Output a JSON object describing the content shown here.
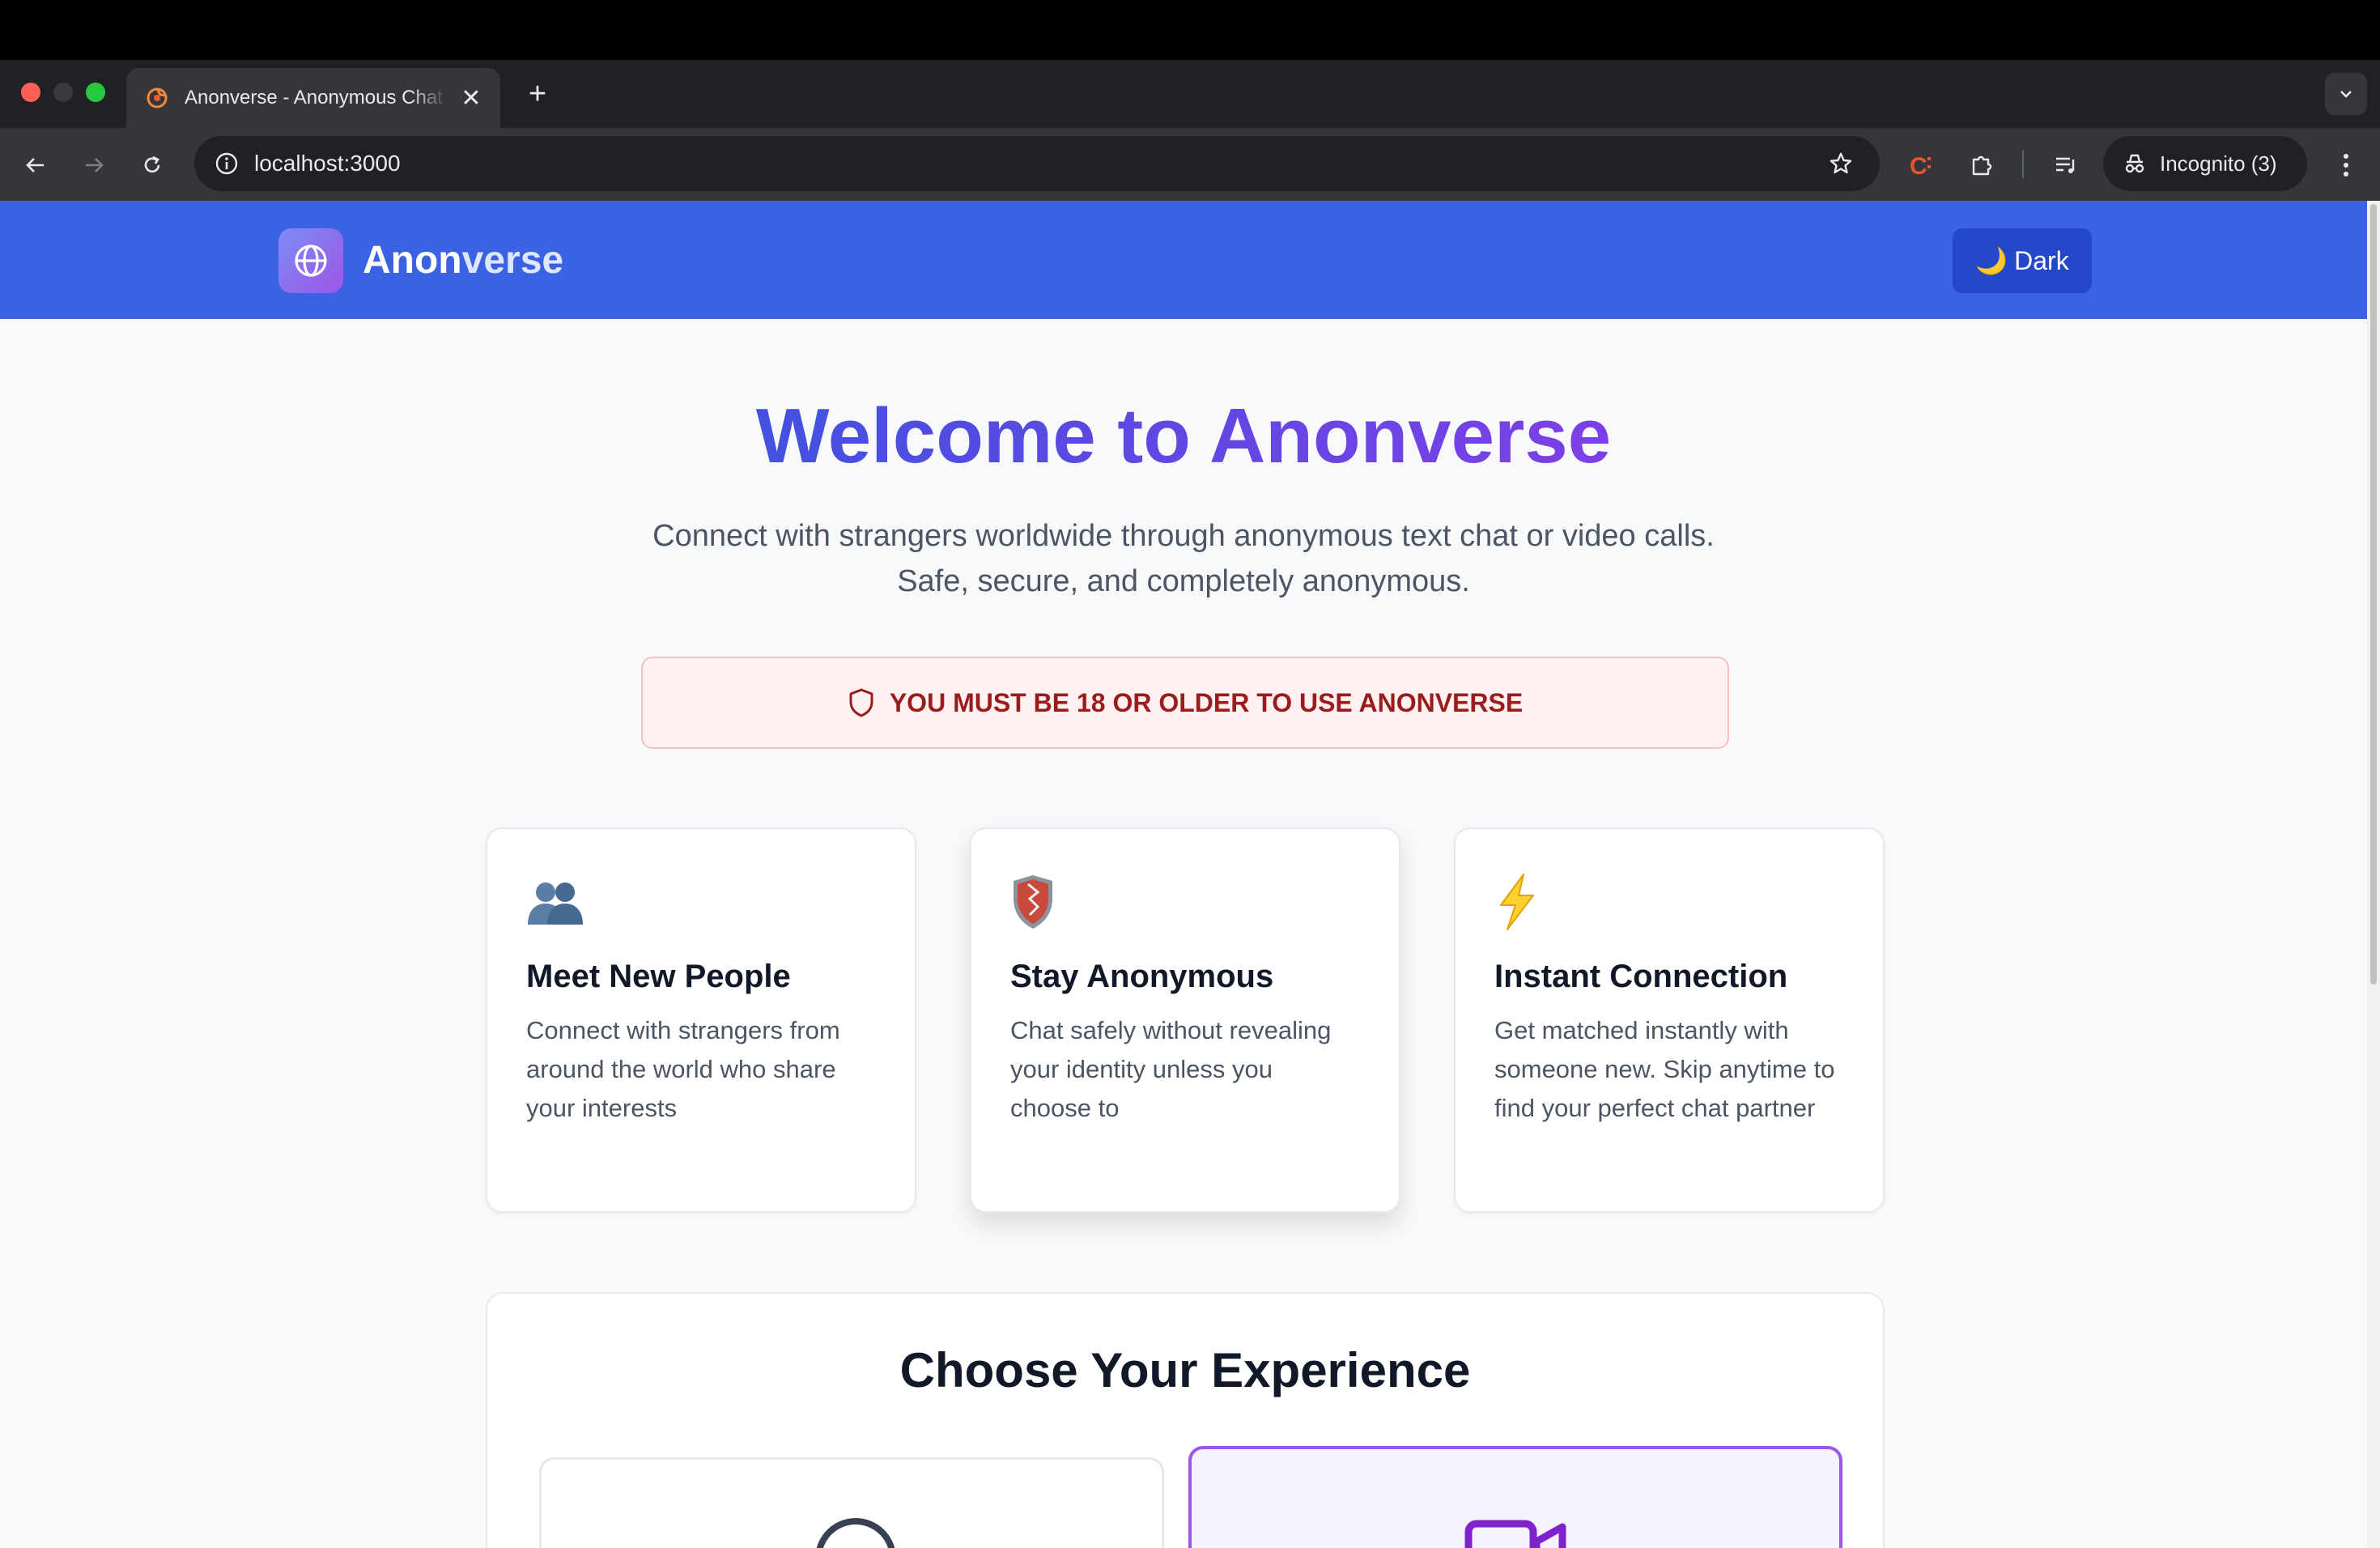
{
  "browser": {
    "tab_title": "Anonverse - Anonymous Chat",
    "tab_close": "✕",
    "new_tab": "+",
    "url": "localhost:3000",
    "profile_label": "Incognito (3)"
  },
  "colors": {
    "header_bg": "#3c62e4",
    "accent_start": "#4451e0",
    "accent_end": "#7d3fe6",
    "warning_text": "#9b1c1c",
    "warning_bg": "#fdf1f1"
  },
  "header": {
    "brand_prefix": "Anon",
    "brand_suffix": "verse",
    "logo_icon": "globe-icon",
    "theme_toggle_icon": "🌙",
    "theme_toggle_label": "Dark"
  },
  "hero": {
    "title": "Welcome to Anonverse",
    "subtitle": "Connect with strangers worldwide through anonymous text chat or video calls. Safe, secure, and completely anonymous."
  },
  "age_notice": {
    "icon": "shield-icon",
    "text": "YOU MUST BE 18 OR OLDER TO USE ANONVERSE"
  },
  "features": [
    {
      "icon": "people-icon",
      "title": "Meet New People",
      "description": "Connect with strangers from around the world who share your interests"
    },
    {
      "icon": "shield-emblem-icon",
      "title": "Stay Anonymous",
      "description": "Chat safely without revealing your identity unless you choose to"
    },
    {
      "icon": "lightning-icon",
      "title": "Instant Connection",
      "description": "Get matched instantly with someone new. Skip anytime to find your perfect chat partner"
    }
  ],
  "experience": {
    "title": "Choose Your Experience",
    "options": [
      {
        "icon": "chat-bubble-icon"
      },
      {
        "icon": "video-camera-icon",
        "selected": true
      }
    ]
  }
}
